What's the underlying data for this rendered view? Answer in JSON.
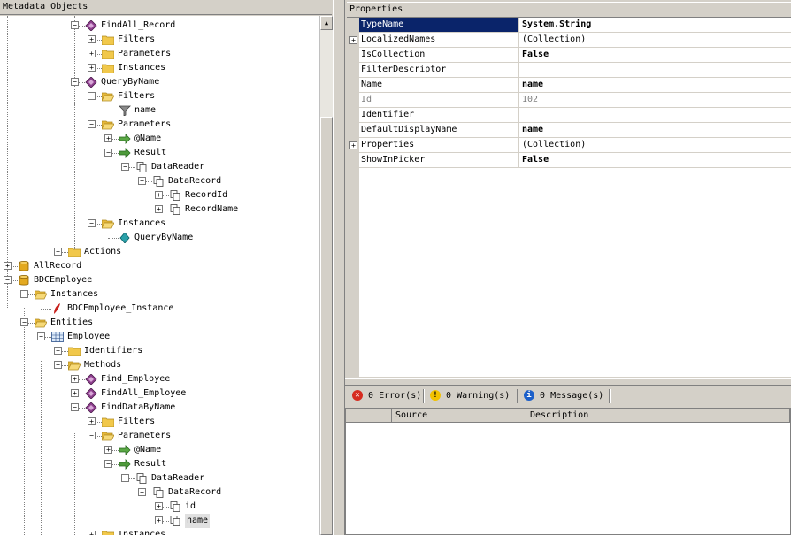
{
  "left_panel": {
    "title": "Metadata Objects"
  },
  "right_panel": {
    "title": "Properties"
  },
  "tree": [
    {
      "label": "FindAll_Record",
      "icon": "method-icon",
      "expander": "-",
      "sel": false
    },
    {
      "label": "Filters",
      "icon": "folder-icon",
      "expander": "+",
      "sel": false
    },
    {
      "label": "Parameters",
      "icon": "folder-icon",
      "expander": "+",
      "sel": false
    },
    {
      "label": "Instances",
      "icon": "folder-icon",
      "expander": "+",
      "sel": false
    },
    {
      "label": "QueryByName",
      "icon": "method-icon",
      "expander": "-",
      "sel": false
    },
    {
      "label": "Filters",
      "icon": "folder-open-icon",
      "expander": "-",
      "sel": false
    },
    {
      "label": "name",
      "icon": "filter-icon",
      "expander": "",
      "sel": false
    },
    {
      "label": "Parameters",
      "icon": "folder-open-icon",
      "expander": "-",
      "sel": false
    },
    {
      "label": "@Name",
      "icon": "arrow-in-icon",
      "expander": "+",
      "sel": false
    },
    {
      "label": "Result",
      "icon": "arrow-out-icon",
      "expander": "-",
      "sel": false
    },
    {
      "label": "DataReader",
      "icon": "type-descriptor-icon",
      "expander": "-",
      "sel": false
    },
    {
      "label": "DataRecord",
      "icon": "type-descriptor-icon",
      "expander": "-",
      "sel": false
    },
    {
      "label": "RecordId",
      "icon": "type-descriptor-icon",
      "expander": "+",
      "sel": false
    },
    {
      "label": "RecordName",
      "icon": "type-descriptor-icon",
      "expander": "+",
      "sel": false
    },
    {
      "label": "Instances",
      "icon": "folder-open-icon",
      "expander": "-",
      "sel": false
    },
    {
      "label": "QueryByName",
      "icon": "instance-icon",
      "expander": "",
      "sel": false
    },
    {
      "label": "Actions",
      "icon": "folder-icon",
      "expander": "+",
      "sel": false
    },
    {
      "label": "AllRecord",
      "icon": "database-icon",
      "expander": "+",
      "sel": false
    },
    {
      "label": "BDCEmployee",
      "icon": "database-icon",
      "expander": "-",
      "sel": false
    },
    {
      "label": "Instances",
      "icon": "folder-open-icon",
      "expander": "-",
      "sel": false
    },
    {
      "label": "BDCEmployee_Instance",
      "icon": "lob-instance-icon",
      "expander": "",
      "sel": false
    },
    {
      "label": "Entities",
      "icon": "folder-open-icon",
      "expander": "-",
      "sel": false
    },
    {
      "label": "Employee",
      "icon": "entity-icon",
      "expander": "-",
      "sel": false
    },
    {
      "label": "Identifiers",
      "icon": "folder-icon",
      "expander": "+",
      "sel": false
    },
    {
      "label": "Methods",
      "icon": "folder-open-icon",
      "expander": "-",
      "sel": false
    },
    {
      "label": "Find_Employee",
      "icon": "method-icon",
      "expander": "+",
      "sel": false
    },
    {
      "label": "FindAll_Employee",
      "icon": "method-icon",
      "expander": "+",
      "sel": false
    },
    {
      "label": "FindDataByName",
      "icon": "method-icon",
      "expander": "-",
      "sel": false
    },
    {
      "label": "Filters",
      "icon": "folder-icon",
      "expander": "+",
      "sel": false
    },
    {
      "label": "Parameters",
      "icon": "folder-open-icon",
      "expander": "-",
      "sel": false
    },
    {
      "label": "@Name",
      "icon": "arrow-in-icon",
      "expander": "+",
      "sel": false
    },
    {
      "label": "Result",
      "icon": "arrow-out-icon",
      "expander": "-",
      "sel": false
    },
    {
      "label": "DataReader",
      "icon": "type-descriptor-icon",
      "expander": "-",
      "sel": false
    },
    {
      "label": "DataRecord",
      "icon": "type-descriptor-icon",
      "expander": "-",
      "sel": false
    },
    {
      "label": "id",
      "icon": "type-descriptor-icon",
      "expander": "+",
      "sel": false
    },
    {
      "label": "name",
      "icon": "type-descriptor-icon",
      "expander": "+",
      "sel": true
    },
    {
      "label": "Instances",
      "icon": "folder-icon",
      "expander": "+",
      "sel": false
    }
  ],
  "properties": [
    {
      "name": "TypeName",
      "value": "System.String",
      "expander": "",
      "bold": true,
      "gray": false,
      "selected": true
    },
    {
      "name": "LocalizedNames",
      "value": "(Collection)",
      "expander": "+",
      "bold": false,
      "gray": false,
      "selected": false
    },
    {
      "name": "IsCollection",
      "value": "False",
      "expander": "",
      "bold": true,
      "gray": false,
      "selected": false
    },
    {
      "name": "FilterDescriptor",
      "value": "",
      "expander": "",
      "bold": false,
      "gray": false,
      "selected": false
    },
    {
      "name": "Name",
      "value": "name",
      "expander": "",
      "bold": true,
      "gray": false,
      "selected": false
    },
    {
      "name": "Id",
      "value": "102",
      "expander": "",
      "bold": false,
      "gray": true,
      "selected": false
    },
    {
      "name": "Identifier",
      "value": "",
      "expander": "",
      "bold": false,
      "gray": false,
      "selected": false
    },
    {
      "name": "DefaultDisplayName",
      "value": "name",
      "expander": "",
      "bold": true,
      "gray": false,
      "selected": false
    },
    {
      "name": "Properties",
      "value": "(Collection)",
      "expander": "+",
      "bold": false,
      "gray": false,
      "selected": false
    },
    {
      "name": "ShowInPicker",
      "value": "False",
      "expander": "",
      "bold": true,
      "gray": false,
      "selected": false
    }
  ],
  "error_list": {
    "errors": "0 Error(s)",
    "warnings": "0 Warning(s)",
    "messages": "0 Message(s)",
    "columns": [
      "Source",
      "Description"
    ]
  },
  "colors": {
    "selection": "#0a246a",
    "error": "#d62b1f",
    "warning": "#f2c200",
    "info": "#1c5fc9"
  }
}
